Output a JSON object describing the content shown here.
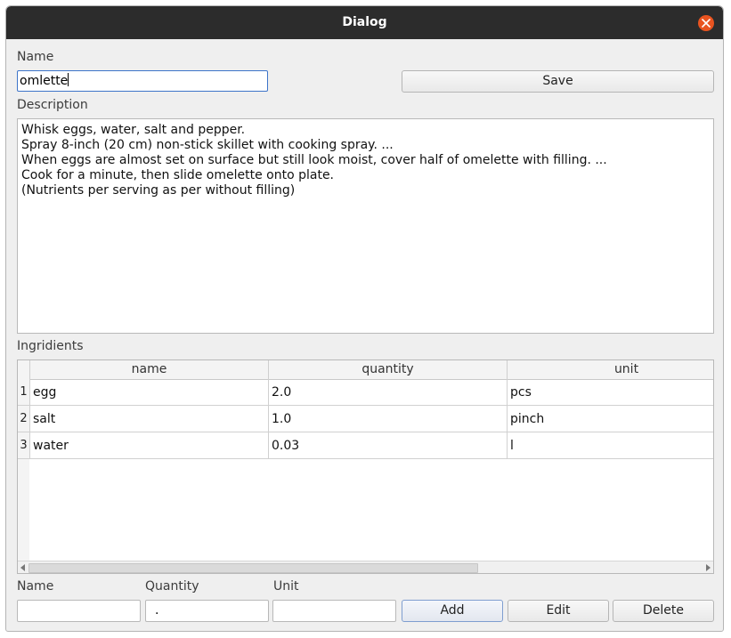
{
  "window": {
    "title": "Dialog"
  },
  "name_section": {
    "label": "Name",
    "value": "omlette",
    "save_label": "Save"
  },
  "description": {
    "label": "Description",
    "lines": [
      "Whisk eggs, water, salt and pepper.",
      "Spray 8-inch (20 cm) non-stick skillet with cooking spray. ...",
      "When eggs are almost set on surface but still look moist, cover half of omelette with filling. ...",
      "Cook for a minute, then slide omelette onto plate.",
      "(Nutrients per serving as per without filling)"
    ]
  },
  "ingredients": {
    "label": "Ingridients",
    "columns": [
      "name",
      "quantity",
      "unit"
    ],
    "rows": [
      {
        "num": "1",
        "name": "egg",
        "quantity": "2.0",
        "unit": "pcs"
      },
      {
        "num": "2",
        "name": "salt",
        "quantity": "1.0",
        "unit": "pinch"
      },
      {
        "num": "3",
        "name": "water",
        "quantity": "0.03",
        "unit": "l"
      }
    ]
  },
  "entry": {
    "name_label": "Name",
    "quantity_label": "Quantity",
    "unit_label": "Unit",
    "name_value": "",
    "quantity_value": ".",
    "unit_value": "",
    "add_label": "Add",
    "edit_label": "Edit",
    "delete_label": "Delete"
  },
  "colors": {
    "titlebar": "#2c2c2c",
    "close_button": "#e95420",
    "focus_border": "#3d74c9"
  }
}
